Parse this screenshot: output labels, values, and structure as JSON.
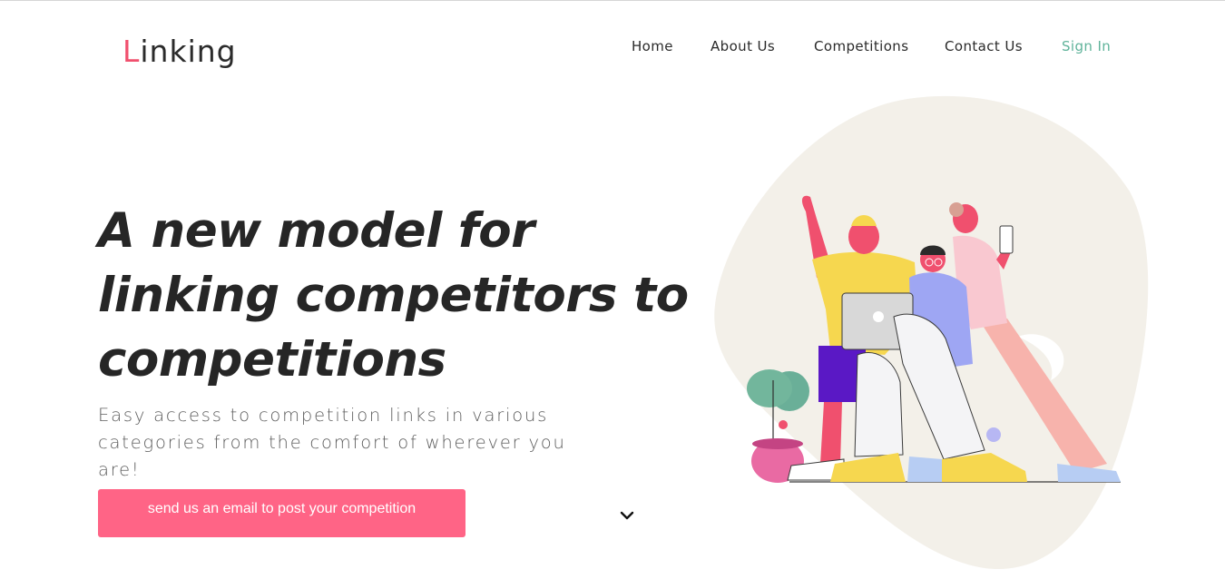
{
  "brand": {
    "logo_first": "L",
    "logo_rest": "inking"
  },
  "nav": {
    "home": "Home",
    "about": "About Us",
    "competitions": "Competitions",
    "contact": "Contact Us",
    "signin": "Sign In"
  },
  "hero": {
    "headline_line1": "A new model for",
    "headline_line2": "linking competitors to",
    "headline_line3": "competitions",
    "subtext": "Easy access to competition links in various categories from the comfort of wherever you are!",
    "cta_label": "send us an email to post your competition"
  },
  "icons": {
    "scroll": "chevron-down-icon",
    "illustration": "people-with-laptop-illustration"
  },
  "colors": {
    "accent": "#f0506e",
    "signin": "#5fb39a",
    "cta": "#ff6486",
    "blob": "#f3f0e9"
  }
}
